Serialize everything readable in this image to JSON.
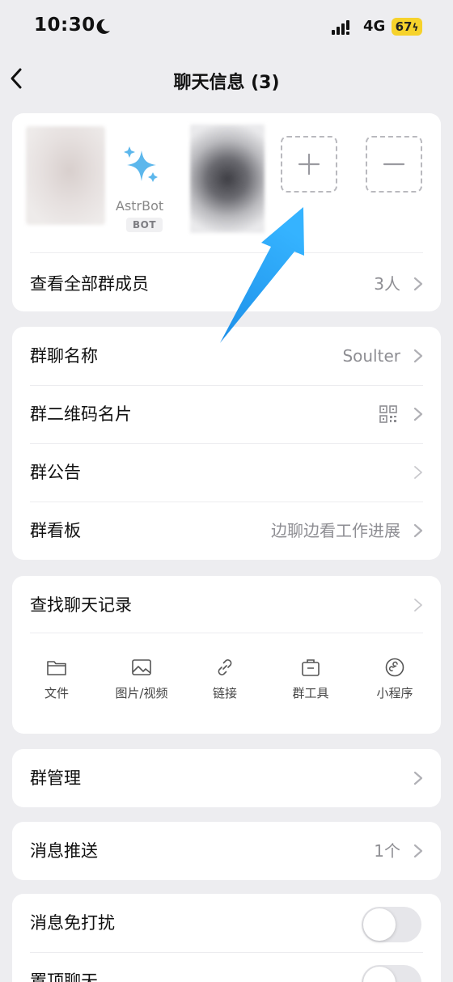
{
  "status_bar": {
    "time": "10:30",
    "network": "4G",
    "battery": "67"
  },
  "nav": {
    "title": "聊天信息 (3)"
  },
  "members": {
    "bot_name": "AstrBot",
    "bot_badge": "BOT",
    "view_all_label": "查看全部群成员",
    "view_all_value": "3人"
  },
  "group_settings": {
    "name_label": "群聊名称",
    "name_value": "Soulter",
    "qr_label": "群二维码名片",
    "notice_label": "群公告",
    "board_label": "群看板",
    "board_value": "边聊边看工作进展"
  },
  "search": {
    "label": "查找聊天记录",
    "tools": [
      "文件",
      "图片/视频",
      "链接",
      "群工具",
      "小程序"
    ]
  },
  "manage": {
    "label": "群管理"
  },
  "push": {
    "label": "消息推送",
    "value": "1个"
  },
  "toggles": {
    "mute_label": "消息免打扰",
    "mute_on": false,
    "pin_label": "置顶聊天",
    "pin_on": false
  },
  "colors": {
    "accent_arrow": "#1a9bf0",
    "battery": "#f6d22b",
    "bot_icon": "#5cb7ec"
  }
}
